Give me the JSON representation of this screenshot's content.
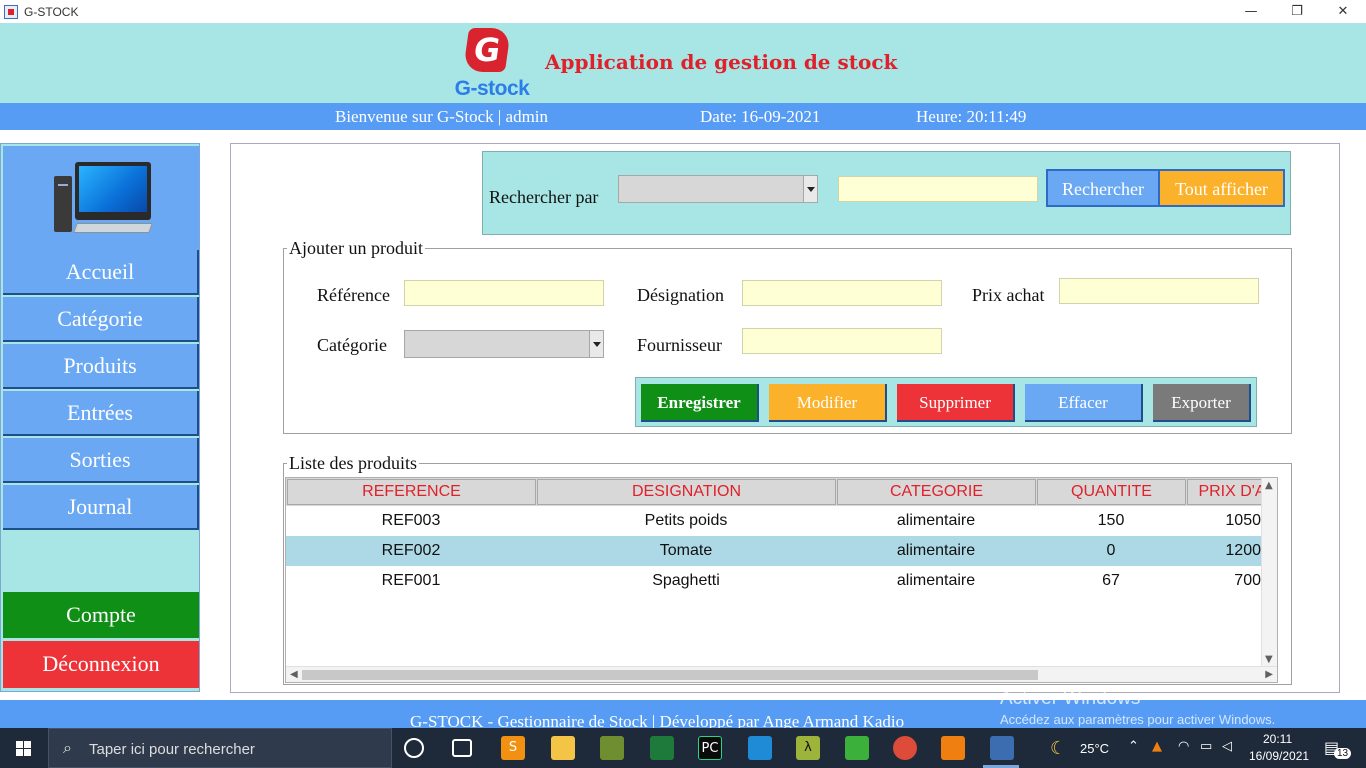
{
  "window": {
    "title": "G-STOCK",
    "minimize": "—",
    "maximize": "❐",
    "close": "✕"
  },
  "header": {
    "logo_letter": "G",
    "logo_text": "G-stock",
    "title": "Application de gestion de stock"
  },
  "infobar": {
    "welcome": "Bienvenue sur G-Stock | admin",
    "date": "Date: 16-09-2021",
    "time": "Heure: 20:11:49"
  },
  "sidebar": {
    "items": [
      {
        "label": "Accueil"
      },
      {
        "label": "Catégorie"
      },
      {
        "label": "Produits"
      },
      {
        "label": "Entrées"
      },
      {
        "label": "Sorties"
      },
      {
        "label": "Journal"
      }
    ],
    "compte": "Compte",
    "deconnexion": "Déconnexion"
  },
  "search": {
    "label": "Rechercher par",
    "combo_value": "",
    "input_value": "",
    "btn_search": "Rechercher",
    "btn_all": "Tout afficher"
  },
  "form": {
    "legend": "Ajouter un produit",
    "reference_label": "Référence",
    "designation_label": "Désignation",
    "prix_label": "Prix achat",
    "categorie_label": "Catégorie",
    "fournisseur_label": "Fournisseur",
    "reference_value": "",
    "designation_value": "",
    "prix_value": "",
    "categorie_value": "",
    "fournisseur_value": "",
    "actions": {
      "save": "Enregistrer",
      "modify": "Modifier",
      "delete": "Supprimer",
      "clear": "Effacer",
      "export": "Exporter"
    }
  },
  "table": {
    "legend": "Liste des produits",
    "headers": [
      "REFERENCE",
      "DESIGNATION",
      "CATEGORIE",
      "QUANTITE",
      "PRIX D'A"
    ],
    "rows": [
      [
        "REF003",
        "Petits poids",
        "alimentaire",
        "150",
        "1050"
      ],
      [
        "REF002",
        "Tomate",
        "alimentaire",
        "0",
        "1200"
      ],
      [
        "REF001",
        "Spaghetti",
        "alimentaire",
        "67",
        "700"
      ]
    ],
    "selected_row": 1
  },
  "footer": {
    "text": "G-STOCK - Gestionnaire de Stock | Développé par Ange Armand Kadio"
  },
  "watermark": {
    "line1": "Activer Windows",
    "line2": "Accédez aux paramètres pour activer Windows."
  },
  "taskbar": {
    "search_placeholder": "Taper ici pour rechercher",
    "temperature": "25°C",
    "time": "20:11",
    "date": "16/09/2021",
    "notifications": "13"
  },
  "colors": {
    "header_bg": "#a8e6e6",
    "bar_blue": "#569cf5",
    "nav_blue": "#6aa8f3",
    "title_red": "#e0202a",
    "save_green": "#0f8f16",
    "modify_orange": "#fbb12a",
    "delete_red": "#ee3338",
    "export_gray": "#7a7a7a"
  }
}
